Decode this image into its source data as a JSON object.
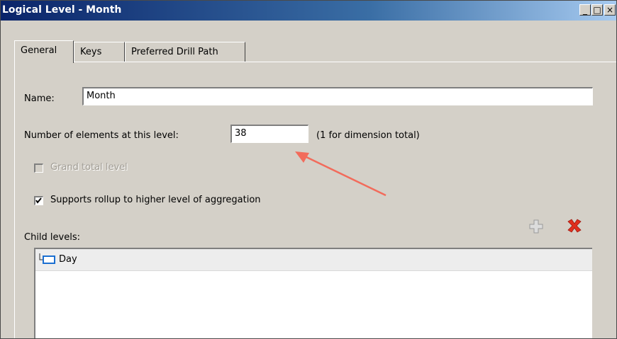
{
  "window": {
    "title": "Logical Level - Month",
    "minimize_glyph": "_",
    "maximize_glyph": "□",
    "close_glyph": "×"
  },
  "tabs": [
    {
      "label": "General",
      "active": true
    },
    {
      "label": "Keys",
      "active": false
    },
    {
      "label": "Preferred Drill Path",
      "active": false
    }
  ],
  "form": {
    "name_label": "Name:",
    "name_value": "Month",
    "elements_label": "Number of elements at this level:",
    "elements_value": "38",
    "elements_hint": "(1 for dimension total)",
    "grand_total_label": "Grand total level",
    "grand_total_checked": false,
    "grand_total_enabled": false,
    "rollup_label": "Supports rollup to higher level of aggregation",
    "rollup_checked": true,
    "child_levels_label": "Child levels:"
  },
  "child_levels": [
    {
      "label": "Day",
      "icon": "level-icon"
    }
  ],
  "toolbar": {
    "add_icon": "plus-icon",
    "delete_icon": "delete-x-icon"
  },
  "colors": {
    "titlebar_start": "#0a246a",
    "titlebar_end": "#a6caf0",
    "dialog_bg": "#d4d0c8",
    "annotation_arrow": "#f26b5b",
    "delete_icon": "#e0301e"
  }
}
